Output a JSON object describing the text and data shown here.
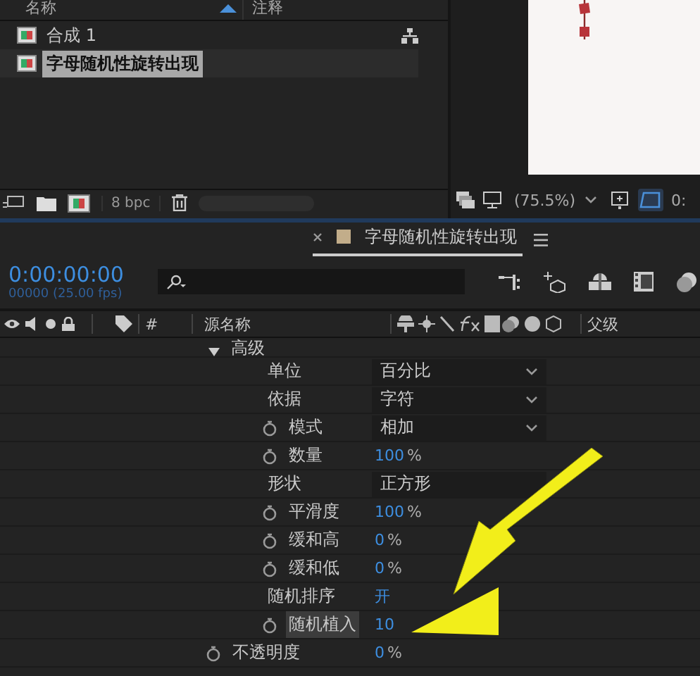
{
  "project": {
    "columns": {
      "name": "名称",
      "notes": "注释"
    },
    "items": [
      {
        "name": "合成 1",
        "selected": false
      },
      {
        "name": "字母随机性旋转出现",
        "selected": true
      }
    ],
    "bit_depth": "8 bpc"
  },
  "viewer": {
    "zoom": "(75.5%)",
    "time": "0:"
  },
  "timeline": {
    "tab": "字母随机性旋转出现",
    "timecode": "0:00:00:00",
    "frame_info": "00000 (25.00 fps)",
    "columns": [
      "#",
      "源名称",
      "父级"
    ],
    "properties": [
      {
        "kind": "group",
        "label": "高级",
        "expanded": true,
        "selected": false
      },
      {
        "kind": "dropdown",
        "label": "单位",
        "stopwatch": false,
        "value": "百分比",
        "selected": false
      },
      {
        "kind": "dropdown",
        "label": "依据",
        "stopwatch": false,
        "value": "字符",
        "selected": false
      },
      {
        "kind": "dropdown",
        "label": "模式",
        "stopwatch": true,
        "value": "相加",
        "selected": false
      },
      {
        "kind": "value",
        "label": "数量",
        "stopwatch": true,
        "value": "100",
        "unit": "%",
        "selected": false
      },
      {
        "kind": "box",
        "label": "形状",
        "stopwatch": false,
        "value": "正方形",
        "selected": false
      },
      {
        "kind": "value",
        "label": "平滑度",
        "stopwatch": true,
        "value": "100",
        "unit": "%",
        "selected": false
      },
      {
        "kind": "value",
        "label": "缓和高",
        "stopwatch": true,
        "value": "0",
        "unit": "%",
        "selected": false
      },
      {
        "kind": "value",
        "label": "缓和低",
        "stopwatch": true,
        "value": "0",
        "unit": "%",
        "selected": false
      },
      {
        "kind": "value",
        "label": "随机排序",
        "stopwatch": false,
        "value": "开",
        "selected": false
      },
      {
        "kind": "value",
        "label": "随机植入",
        "stopwatch": true,
        "value": "10",
        "selected": true
      },
      {
        "kind": "top",
        "label": "不透明度",
        "stopwatch": true,
        "value": "0",
        "unit": "%",
        "selected": false
      }
    ]
  }
}
